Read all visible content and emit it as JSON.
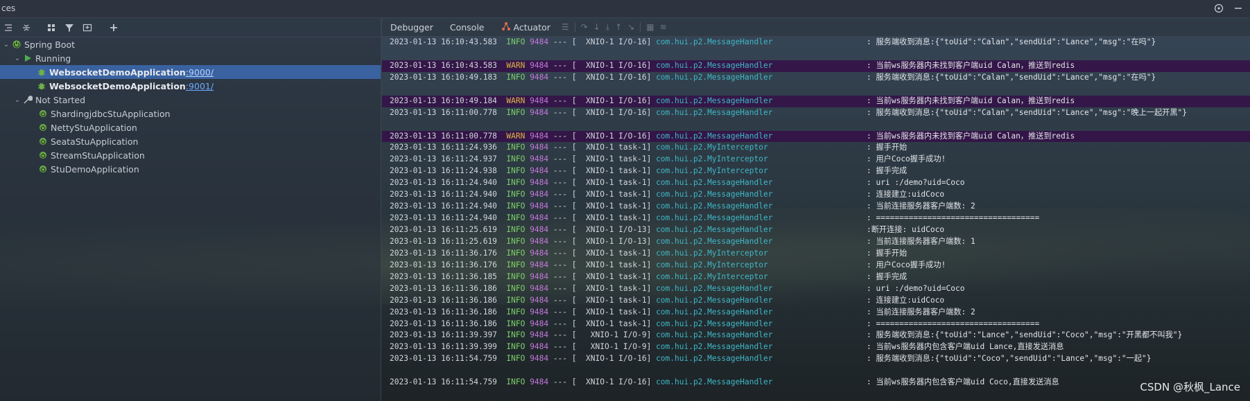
{
  "window": {
    "title": "ces"
  },
  "left_panel": {
    "tree": [
      {
        "label": "Spring Boot",
        "level": 0,
        "expanded": true,
        "icon": "spring-boot-icon"
      },
      {
        "label": "Running",
        "level": 1,
        "expanded": true,
        "icon": "run-icon"
      },
      {
        "label": "WebsocketDemoApplication",
        "port": ":9000/",
        "level": 2,
        "selected": true,
        "bold": true,
        "icon": "bug-icon"
      },
      {
        "label": "WebsocketDemoApplication",
        "port": ":9001/",
        "level": 2,
        "selected": false,
        "bold": true,
        "icon": "bug-icon"
      },
      {
        "label": "Not Started",
        "level": 1,
        "expanded": true,
        "icon": "wrench-icon"
      },
      {
        "label": "ShardingjdbcStuApplication",
        "level": 2,
        "icon": "spring-app-icon"
      },
      {
        "label": "NettyStuApplication",
        "level": 2,
        "icon": "spring-app-icon"
      },
      {
        "label": "SeataStuApplication",
        "level": 2,
        "icon": "spring-app-icon"
      },
      {
        "label": "StreamStuApplication",
        "level": 2,
        "icon": "spring-app-icon"
      },
      {
        "label": "StuDemoApplication",
        "level": 2,
        "icon": "spring-app-icon"
      }
    ]
  },
  "right_panel": {
    "tabs": [
      {
        "label": "Debugger"
      },
      {
        "label": "Console"
      },
      {
        "label": "Actuator"
      }
    ],
    "log": [
      {
        "ts": "2023-01-13 16:10:43.583",
        "level": "INFO",
        "pid": "9484",
        "thread": "XNIO-1 I/O-16]",
        "cls": "com.hui.p2.MessageHandler",
        "msg": ": 服务端收到消息:{\"toUid\":\"Calan\",\"sendUid\":\"Lance\",\"msg\":\"在吗\"}"
      },
      {
        "blank": true
      },
      {
        "ts": "2023-01-13 16:10:43.583",
        "level": "WARN",
        "pid": "9484",
        "thread": "XNIO-1 I/O-16]",
        "cls": "com.hui.p2.MessageHandler",
        "msg": ": 当前ws服务器内未找到客户端uid Calan，推送到redis",
        "hl": true
      },
      {
        "ts": "2023-01-13 16:10:49.183",
        "level": "INFO",
        "pid": "9484",
        "thread": "XNIO-1 I/O-16]",
        "cls": "com.hui.p2.MessageHandler",
        "msg": ": 服务端收到消息:{\"toUid\":\"Calan\",\"sendUid\":\"Lance\",\"msg\":\"在吗\"}"
      },
      {
        "blank": true
      },
      {
        "ts": "2023-01-13 16:10:49.184",
        "level": "WARN",
        "pid": "9484",
        "thread": "XNIO-1 I/O-16]",
        "cls": "com.hui.p2.MessageHandler",
        "msg": ": 当前ws服务器内未找到客户端uid Calan，推送到redis",
        "hl": true
      },
      {
        "ts": "2023-01-13 16:11:00.778",
        "level": "INFO",
        "pid": "9484",
        "thread": "XNIO-1 I/O-16]",
        "cls": "com.hui.p2.MessageHandler",
        "msg": ": 服务端收到消息:{\"toUid\":\"Calan\",\"sendUid\":\"Lance\",\"msg\":\"晚上一起开黑\"}"
      },
      {
        "blank": true
      },
      {
        "ts": "2023-01-13 16:11:00.778",
        "level": "WARN",
        "pid": "9484",
        "thread": "XNIO-1 I/O-16]",
        "cls": "com.hui.p2.MessageHandler",
        "msg": ": 当前ws服务器内未找到客户端uid Calan，推送到redis",
        "hl": true
      },
      {
        "ts": "2023-01-13 16:11:24.936",
        "level": "INFO",
        "pid": "9484",
        "thread": "XNIO-1 task-1]",
        "cls": "com.hui.p2.MyInterceptor",
        "msg": ": 握手开始"
      },
      {
        "ts": "2023-01-13 16:11:24.937",
        "level": "INFO",
        "pid": "9484",
        "thread": "XNIO-1 task-1]",
        "cls": "com.hui.p2.MyInterceptor",
        "msg": ": 用户Coco握手成功!"
      },
      {
        "ts": "2023-01-13 16:11:24.938",
        "level": "INFO",
        "pid": "9484",
        "thread": "XNIO-1 task-1]",
        "cls": "com.hui.p2.MyInterceptor",
        "msg": ": 握手完成"
      },
      {
        "ts": "2023-01-13 16:11:24.940",
        "level": "INFO",
        "pid": "9484",
        "thread": "XNIO-1 task-1]",
        "cls": "com.hui.p2.MessageHandler",
        "msg": ": uri :/demo?uid=Coco"
      },
      {
        "ts": "2023-01-13 16:11:24.940",
        "level": "INFO",
        "pid": "9484",
        "thread": "XNIO-1 task-1]",
        "cls": "com.hui.p2.MessageHandler",
        "msg": ": 连接建立:uidCoco"
      },
      {
        "ts": "2023-01-13 16:11:24.940",
        "level": "INFO",
        "pid": "9484",
        "thread": "XNIO-1 task-1]",
        "cls": "com.hui.p2.MessageHandler",
        "msg": ": 当前连接服务器客户端数: 2"
      },
      {
        "ts": "2023-01-13 16:11:24.940",
        "level": "INFO",
        "pid": "9484",
        "thread": "XNIO-1 task-1]",
        "cls": "com.hui.p2.MessageHandler",
        "msg": ": ==================================="
      },
      {
        "ts": "2023-01-13 16:11:25.619",
        "level": "INFO",
        "pid": "9484",
        "thread": "XNIO-1 I/O-13]",
        "cls": "com.hui.p2.MessageHandler",
        "msg": ":断开连接: uidCoco"
      },
      {
        "ts": "2023-01-13 16:11:25.619",
        "level": "INFO",
        "pid": "9484",
        "thread": "XNIO-1 I/O-13]",
        "cls": "com.hui.p2.MessageHandler",
        "msg": ": 当前连接服务器客户端数: 1"
      },
      {
        "ts": "2023-01-13 16:11:36.176",
        "level": "INFO",
        "pid": "9484",
        "thread": "XNIO-1 task-1]",
        "cls": "com.hui.p2.MyInterceptor",
        "msg": ": 握手开始"
      },
      {
        "ts": "2023-01-13 16:11:36.176",
        "level": "INFO",
        "pid": "9484",
        "thread": "XNIO-1 task-1]",
        "cls": "com.hui.p2.MyInterceptor",
        "msg": ": 用户Coco握手成功!"
      },
      {
        "ts": "2023-01-13 16:11:36.185",
        "level": "INFO",
        "pid": "9484",
        "thread": "XNIO-1 task-1]",
        "cls": "com.hui.p2.MyInterceptor",
        "msg": ": 握手完成"
      },
      {
        "ts": "2023-01-13 16:11:36.186",
        "level": "INFO",
        "pid": "9484",
        "thread": "XNIO-1 task-1]",
        "cls": "com.hui.p2.MessageHandler",
        "msg": ": uri :/demo?uid=Coco"
      },
      {
        "ts": "2023-01-13 16:11:36.186",
        "level": "INFO",
        "pid": "9484",
        "thread": "XNIO-1 task-1]",
        "cls": "com.hui.p2.MessageHandler",
        "msg": ": 连接建立:uidCoco"
      },
      {
        "ts": "2023-01-13 16:11:36.186",
        "level": "INFO",
        "pid": "9484",
        "thread": "XNIO-1 task-1]",
        "cls": "com.hui.p2.MessageHandler",
        "msg": ": 当前连接服务器客户端数: 2"
      },
      {
        "ts": "2023-01-13 16:11:36.186",
        "level": "INFO",
        "pid": "9484",
        "thread": "XNIO-1 task-1]",
        "cls": "com.hui.p2.MessageHandler",
        "msg": ": ==================================="
      },
      {
        "ts": "2023-01-13 16:11:39.397",
        "level": "INFO",
        "pid": "9484",
        "thread": " XNIO-1 I/O-9]",
        "cls": "com.hui.p2.MessageHandler",
        "msg": ": 服务端收到消息:{\"toUid\":\"Lance\",\"sendUid\":\"Coco\",\"msg\":\"开黑都不叫我\"}"
      },
      {
        "ts": "2023-01-13 16:11:39.399",
        "level": "INFO",
        "pid": "9484",
        "thread": " XNIO-1 I/O-9]",
        "cls": "com.hui.p2.MessageHandler",
        "msg": ": 当前ws服务器内包含客户端uid Lance,直接发送消息"
      },
      {
        "ts": "2023-01-13 16:11:54.759",
        "level": "INFO",
        "pid": "9484",
        "thread": "XNIO-1 I/O-16]",
        "cls": "com.hui.p2.MessageHandler",
        "msg": ": 服务端收到消息:{\"toUid\":\"Coco\",\"sendUid\":\"Lance\",\"msg\":\"一起\"}"
      },
      {
        "blank": true
      },
      {
        "ts": "2023-01-13 16:11:54.759",
        "level": "INFO",
        "pid": "9484",
        "thread": "XNIO-1 I/O-16]",
        "cls": "com.hui.p2.MessageHandler",
        "msg": ": 当前ws服务器内包含客户端uid Coco,直接发送消息"
      }
    ],
    "separator": "---",
    "bracket": "["
  },
  "watermark": "CSDN @秋枫_Lance",
  "colors": {
    "info": "#7fd36b",
    "warn": "#e0b34a",
    "pid": "#c678dd",
    "class": "#3fb7c6",
    "selection": "#3a62a0",
    "warn_row_bg": "#341448"
  }
}
